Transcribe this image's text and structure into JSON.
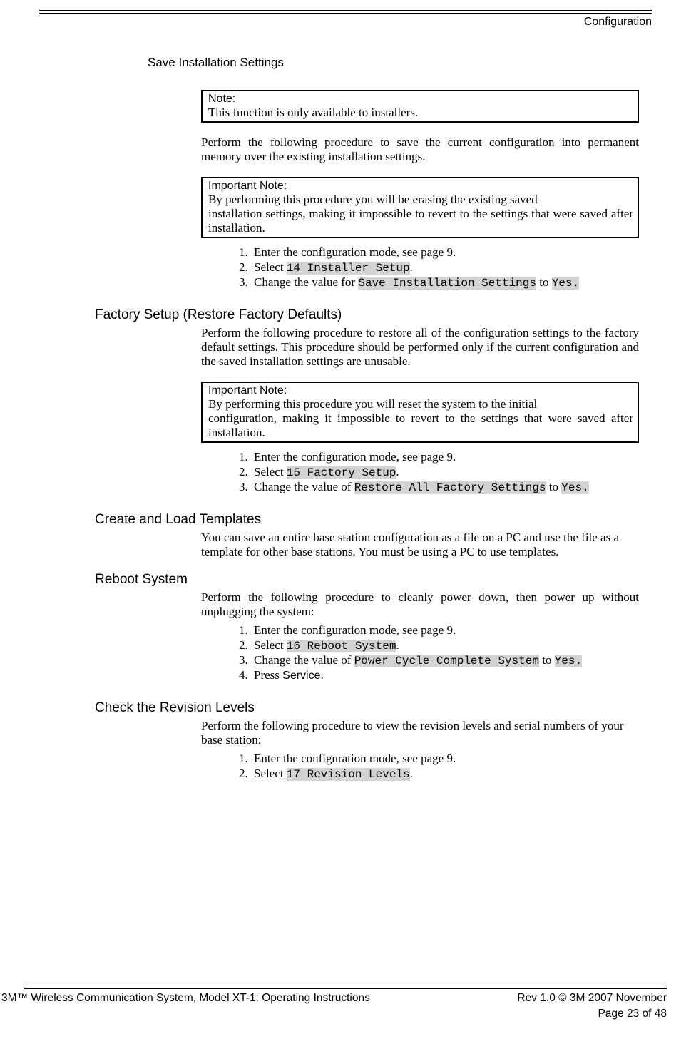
{
  "header": {
    "section": "Configuration"
  },
  "s1": {
    "title": "Save Installation Settings",
    "note": {
      "label": "Note:",
      "body": "This function is only available to installers."
    },
    "intro": "Perform the following procedure to save the current configuration into permanent memory over the existing installation settings.",
    "important": {
      "label": "Important Note:",
      "body1": "By performing this procedure you will be erasing the existing saved",
      "body2": "installation settings, making it impossible to revert to the settings that were saved after installation."
    },
    "steps": {
      "a": "Enter the configuration mode, see page 9.",
      "b_pre": "Select ",
      "b_mono": "14 Installer Setup",
      "b_post": ".",
      "c_pre": "Change the value for  ",
      "c_mono1": "Save Installation Settings",
      "c_mid": " to ",
      "c_mono2": "Yes.",
      "c_post": ""
    }
  },
  "s2": {
    "title": "Factory Setup (Restore Factory Defaults)",
    "intro": "Perform the following procedure to restore all of the configuration settings to the factory default settings.  This procedure should be performed only if the current configuration and the saved installation settings are unusable.",
    "important": {
      "label": "Important Note:",
      "body1": "By performing this procedure you will reset the system to the initial",
      "body2": "configuration, making it impossible to revert to the settings that were saved after installation."
    },
    "steps": {
      "a": "Enter the configuration mode, see page 9.",
      "b_pre": "Select ",
      "b_mono": "15 Factory Setup",
      "b_post": ".",
      "c_pre": "Change the value of  ",
      "c_mono1": "Restore All Factory Settings",
      "c_mid": " to ",
      "c_mono2": "Yes.",
      "c_post": ""
    }
  },
  "s3": {
    "title": "Create and Load Templates",
    "intro": "You can save an entire base station configuration as a file on a PC and use the file as a template for other base stations.  You must be using a PC to use templates."
  },
  "s4": {
    "title": "Reboot System",
    "intro": "Perform the following procedure to cleanly power down, then power up without unplugging the system:",
    "steps": {
      "a": "Enter the configuration mode, see page 9.",
      "b_pre": "Select ",
      "b_mono": "16 Reboot System",
      "b_post": ".",
      "c_pre": "Change the value of  ",
      "c_mono1": "Power Cycle Complete System",
      "c_mid": " to ",
      "c_mono2": "Yes.",
      "c_post": "",
      "d_pre": "Press ",
      "d_sans": "Service",
      "d_post": "."
    }
  },
  "s5": {
    "title": "Check the Revision Levels",
    "intro": "Perform the following procedure to view the revision levels and serial numbers of your base station:",
    "steps": {
      "a": "Enter the configuration mode, see page 9.",
      "b_pre": "Select  ",
      "b_mono": "17 Revision Levels",
      "b_post": "."
    }
  },
  "footer": {
    "left": "3M™ Wireless Communication System, Model XT-1: Operating Instructions",
    "right": "Rev 1.0 © 3M 2007 November",
    "page": "Page 23 of 48"
  }
}
